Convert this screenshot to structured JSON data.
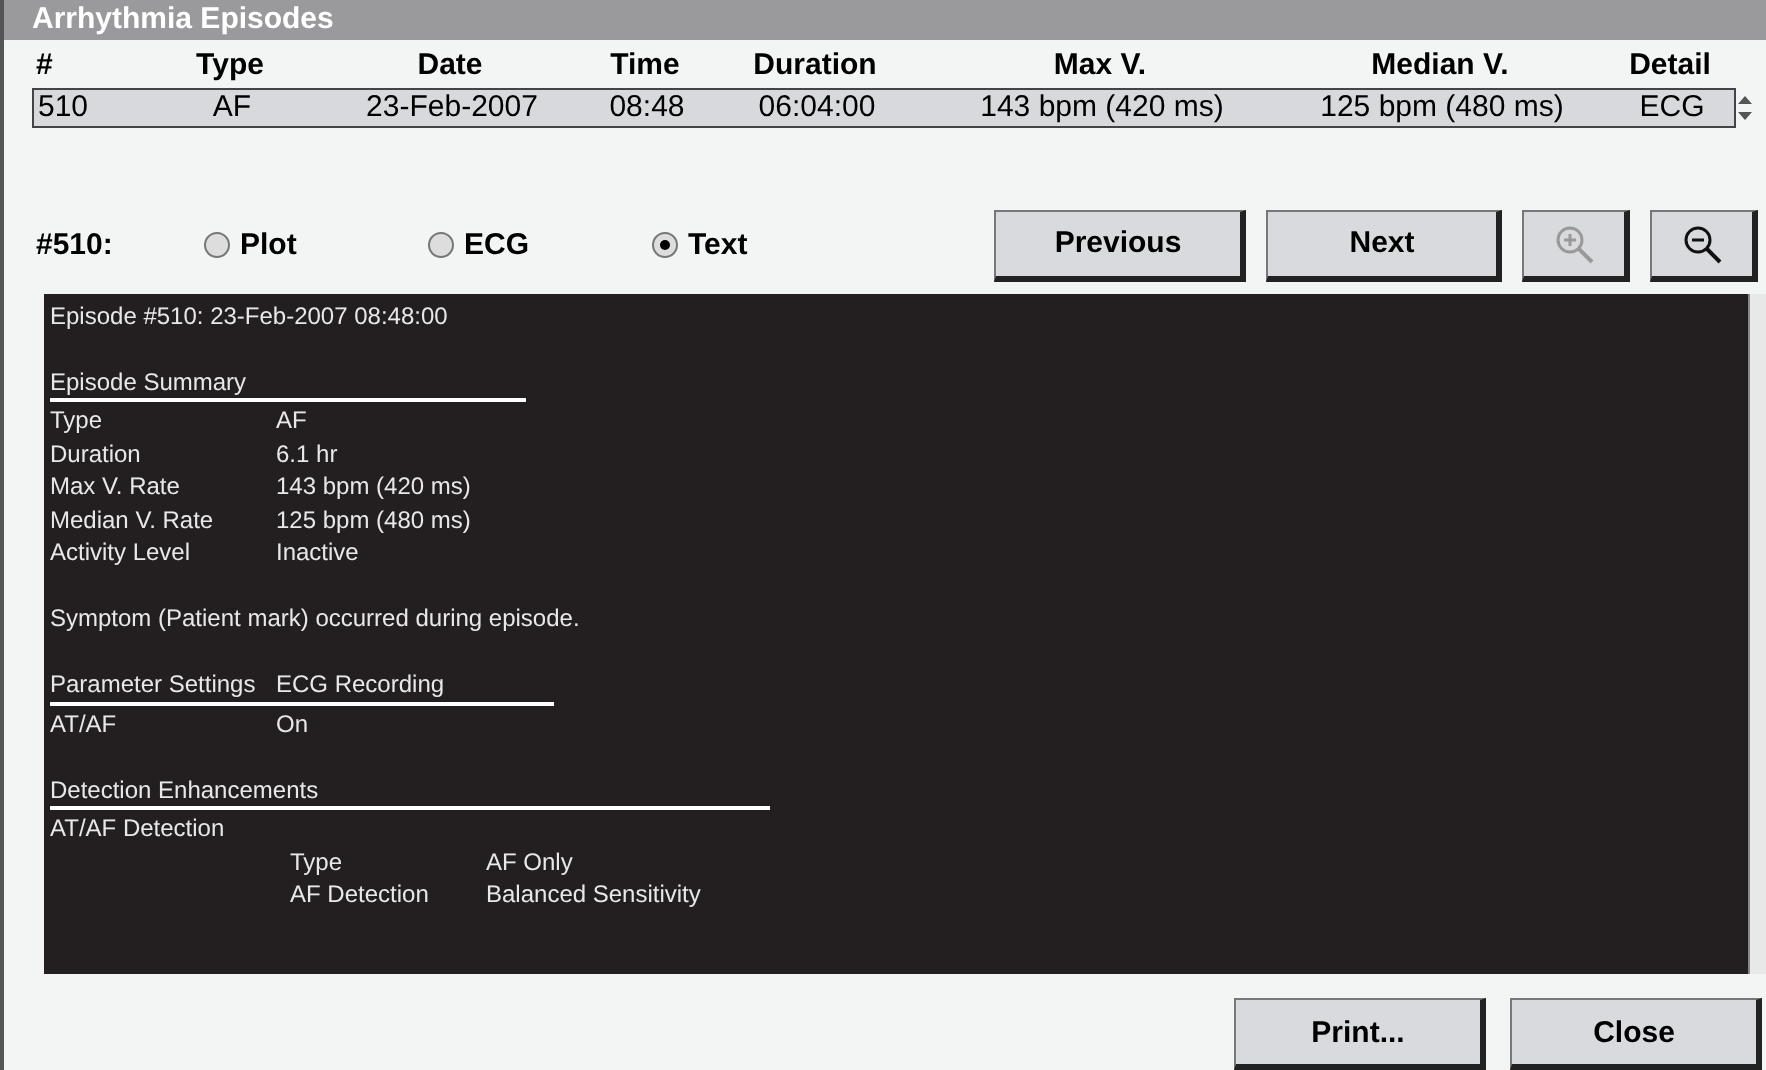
{
  "window": {
    "title": "Arrhythmia Episodes"
  },
  "table": {
    "columns": [
      "#",
      "Type",
      "Date",
      "Time",
      "Duration",
      "Max V.",
      "Median V.",
      "Detail"
    ],
    "rows": [
      {
        "cells": [
          "510",
          "AF",
          "23-Feb-2007",
          "08:48",
          "06:04:00",
          "143 bpm (420 ms)",
          "125 bpm (480 ms)",
          "ECG"
        ],
        "selected": true
      }
    ]
  },
  "episode_label": "#510:",
  "view_options": [
    {
      "label": "Plot",
      "selected": false
    },
    {
      "label": "ECG",
      "selected": false
    },
    {
      "label": "Text",
      "selected": true
    }
  ],
  "nav_buttons": [
    "Previous",
    "Next"
  ],
  "zoom_buttons": [
    {
      "kind": "zoom-in",
      "disabled": true
    },
    {
      "kind": "zoom-out",
      "disabled": false
    }
  ],
  "report": [
    {
      "kind": "line",
      "text": "Episode #510: 23-Feb-2007 08:48:00"
    },
    {
      "kind": "blank"
    },
    {
      "kind": "heading",
      "columns": [
        "Episode Summary"
      ]
    },
    {
      "kind": "row",
      "label": "Type",
      "value": "AF"
    },
    {
      "kind": "row",
      "label": "Duration",
      "value": "6.1 hr"
    },
    {
      "kind": "row",
      "label": "Max V. Rate",
      "value": "143 bpm (420 ms)"
    },
    {
      "kind": "row",
      "label": "Median V. Rate",
      "value": "125 bpm (480 ms)"
    },
    {
      "kind": "row",
      "label": "Activity Level",
      "value": "Inactive"
    },
    {
      "kind": "blank"
    },
    {
      "kind": "line",
      "text": "Symptom (Patient mark) occurred during episode."
    },
    {
      "kind": "blank"
    },
    {
      "kind": "heading",
      "columns": [
        "Parameter Settings",
        "ECG Recording"
      ]
    },
    {
      "kind": "row",
      "label": "AT/AF",
      "value": "On"
    },
    {
      "kind": "blank"
    },
    {
      "kind": "heading",
      "columns": [
        "Detection Enhancements"
      ]
    },
    {
      "kind": "line",
      "text": "AT/AF Detection"
    },
    {
      "kind": "subrow",
      "label": "Type",
      "value": "AF Only"
    },
    {
      "kind": "subrow",
      "label": "AF Detection",
      "value": "Balanced Sensitivity"
    }
  ],
  "footer_buttons": [
    "Print...",
    "Close"
  ]
}
